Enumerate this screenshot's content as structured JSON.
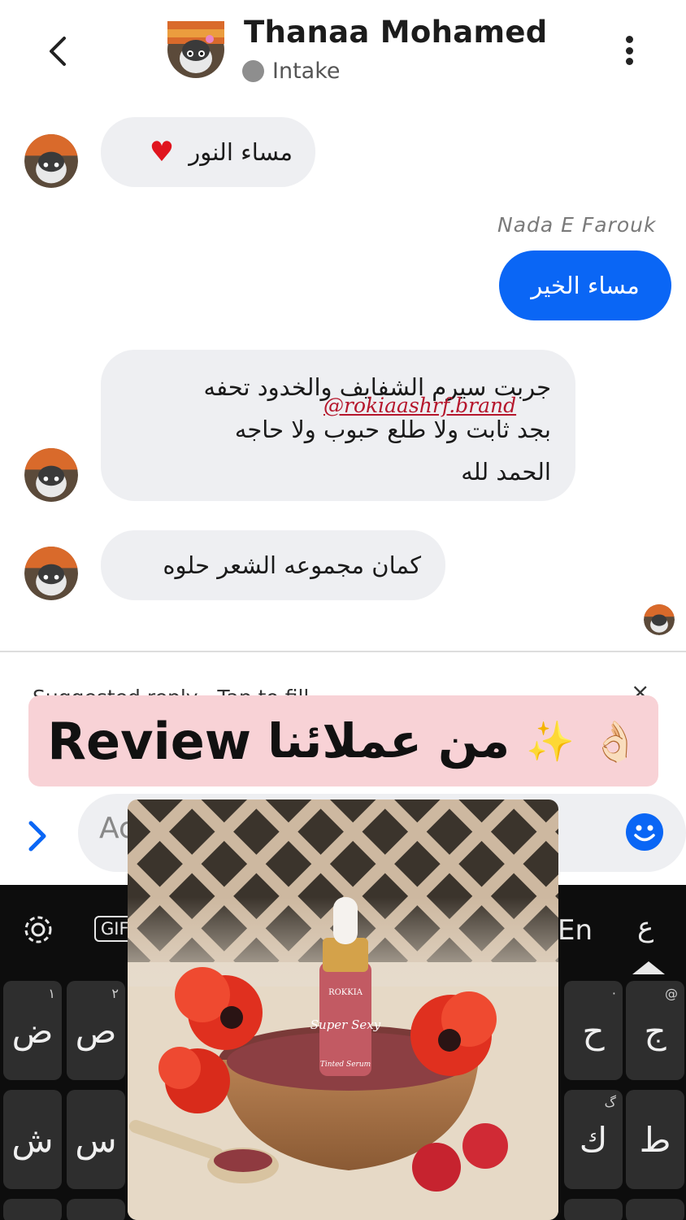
{
  "header": {
    "contact_name": "Thanaa Mohamed",
    "status": "Intake",
    "back_icon": "chevron-left-icon",
    "menu_icon": "more-vertical-icon"
  },
  "messages": [
    {
      "direction": "incoming",
      "text": "مساء النور",
      "emoji": "♥"
    },
    {
      "direction": "outgoing",
      "sender": "Nada E Farouk",
      "text": "مساء الخير"
    },
    {
      "direction": "incoming",
      "lines": [
        "جربت سيرم الشفايف والخدود تحفه",
        "بجد ثابت ولا طلع حبوب  ولا حاجه",
        "الحمد لله"
      ]
    },
    {
      "direction": "incoming",
      "text": "كمان مجموعه الشعر حلوه"
    }
  ],
  "watermark": "@rokiaashrf.brand",
  "suggested": {
    "label": "Suggested reply · Tap to fill",
    "close": "×"
  },
  "banner": {
    "word": "Review",
    "arabic": "من عملائنا",
    "sparkles": "✨",
    "hand": "👌🏻"
  },
  "composer": {
    "placeholder": "Ac"
  },
  "keyboard": {
    "gif": "GIF",
    "lang_en": "En",
    "lang_ar": "ع",
    "keys": [
      {
        "char": "ض",
        "hint": "١"
      },
      {
        "char": "ص",
        "hint": "٢"
      },
      {
        "char": "ح",
        "hint": "·"
      },
      {
        "char": "ج",
        "hint": "@"
      },
      {
        "char": "ش",
        "hint": ""
      },
      {
        "char": "س",
        "hint": ""
      },
      {
        "char": "ك",
        "hint": "گ"
      },
      {
        "char": "ط",
        "hint": ""
      }
    ]
  },
  "product": {
    "brand": "ROKKIA",
    "name": "Super Sexy",
    "type": "Tinted Serum"
  },
  "colors": {
    "outgoing_bubble": "#0a66f5",
    "incoming_bubble": "#eeeff2",
    "banner_bg": "#f8d2d6",
    "watermark": "#b5162c",
    "keyboard_bg": "#0d0d0d"
  }
}
